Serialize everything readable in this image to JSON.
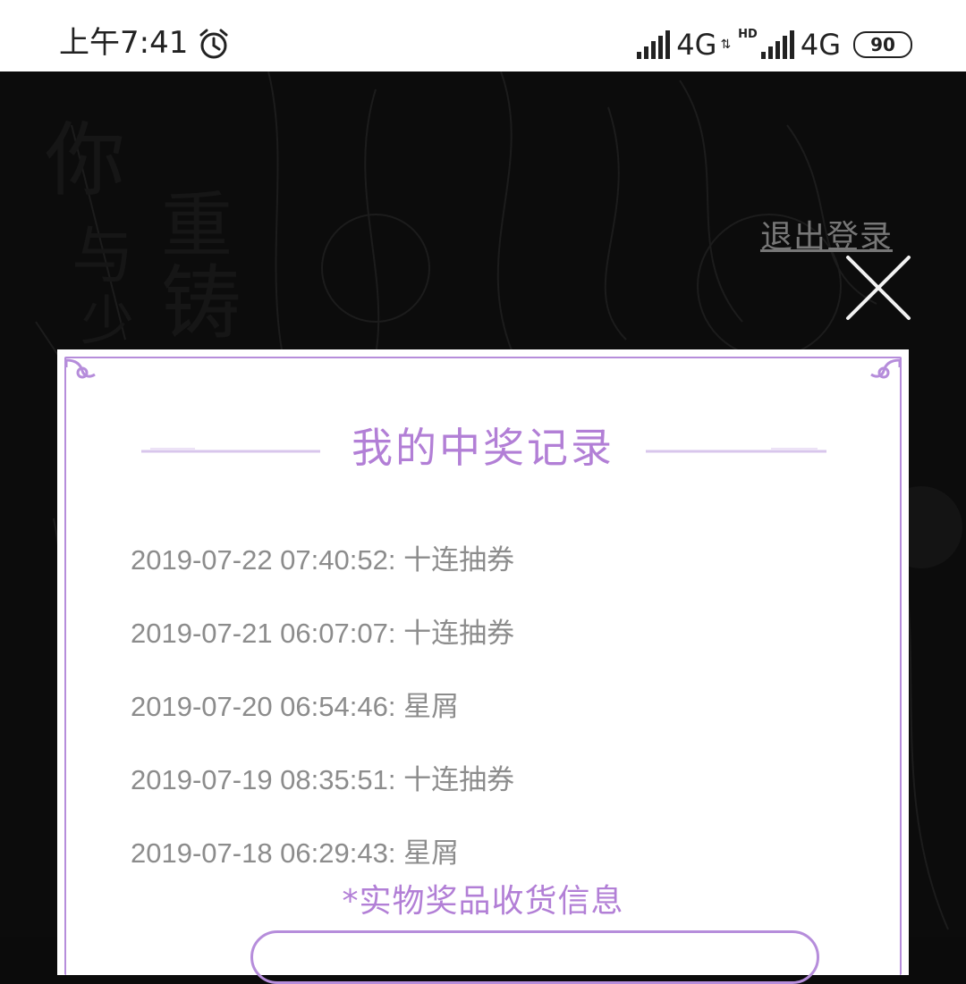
{
  "status_bar": {
    "time": "上午7:41",
    "network_1": "4G",
    "hd_label": "HD",
    "network_2": "4G",
    "battery": "90"
  },
  "header": {
    "logout_label": "退出登录"
  },
  "modal": {
    "title": "我的中奖记录",
    "records": [
      {
        "text": "2019-07-22 07:40:52: 十连抽券"
      },
      {
        "text": "2019-07-21 06:07:07: 十连抽券"
      },
      {
        "text": "2019-07-20 06:54:46: 星屑"
      },
      {
        "text": "2019-07-19 08:35:51: 十连抽券"
      },
      {
        "text": "2019-07-18 06:29:43: 星屑"
      }
    ],
    "shipping_label": "*实物奖品收货信息"
  },
  "colors": {
    "accent_purple": "#b27fd6",
    "frame_purple": "#b68ddb",
    "record_gray": "#8c8c8c",
    "backdrop": "#0b0b0b"
  }
}
